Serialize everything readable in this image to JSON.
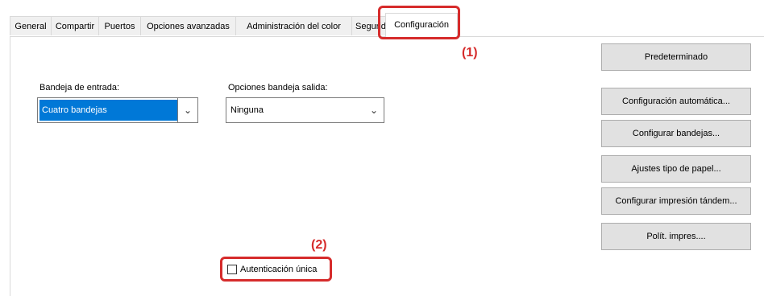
{
  "tabs": [
    {
      "label": "General"
    },
    {
      "label": "Compartir"
    },
    {
      "label": "Puertos"
    },
    {
      "label": "Opciones avanzadas"
    },
    {
      "label": "Administración del color"
    },
    {
      "label": "Segurid"
    },
    {
      "label": "Configuración",
      "active": true
    }
  ],
  "annotations": {
    "step1": "(1)",
    "step2": "(2)",
    "color": "#d62b2b"
  },
  "input_tray": {
    "label": "Bandeja de entrada:",
    "value": "Cuatro bandejas"
  },
  "output_tray": {
    "label": "Opciones bandeja salida:",
    "value": "Ninguna"
  },
  "buttons": {
    "default": "Predeterminado",
    "auto_config": "Configuración automática...",
    "config_trays": "Configurar bandejas...",
    "paper_type": "Ajustes tipo de papel...",
    "tandem": "Configurar impresión tándem...",
    "policy": "Polít. impres...."
  },
  "single_sign_on": {
    "label": "Autenticación única",
    "checked": false
  },
  "colors": {
    "selection": "#0078d7",
    "button_bg": "#e1e1e1"
  }
}
